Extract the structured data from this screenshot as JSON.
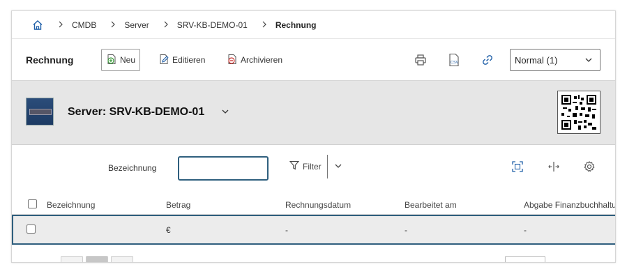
{
  "breadcrumb": {
    "home_icon": "home-icon",
    "items": [
      "CMDB",
      "Server",
      "SRV-KB-DEMO-01"
    ],
    "current": "Rechnung"
  },
  "toolbar": {
    "title": "Rechnung",
    "new_label": "Neu",
    "edit_label": "Editieren",
    "archive_label": "Archivieren",
    "icons": [
      "print-icon",
      "csv-export-icon",
      "link-icon"
    ],
    "view_select": "Normal (1)"
  },
  "object": {
    "title": "Server: SRV-KB-DEMO-01",
    "image_icon": "server-image",
    "qr_icon": "qr-code-icon"
  },
  "filter": {
    "label": "Bezeichnung",
    "value": "",
    "filter_label": "Filter",
    "icons": [
      "fullscreen-icon",
      "column-resize-icon",
      "settings-icon"
    ]
  },
  "table": {
    "columns": [
      "Bezeichnung",
      "Betrag",
      "Rechnungsdatum",
      "Bearbeitet am",
      "Abgabe Finanzbuchhaltung"
    ],
    "rows": [
      [
        "",
        "€",
        "-",
        "-",
        "-"
      ]
    ]
  },
  "colors": {
    "accent": "#2f5f7e",
    "header_bg": "#e6e6e6",
    "row_bg": "#ececec",
    "link_blue": "#1f5fa8",
    "new_green": "#3a9a3a",
    "archive_red": "#c9302c"
  }
}
